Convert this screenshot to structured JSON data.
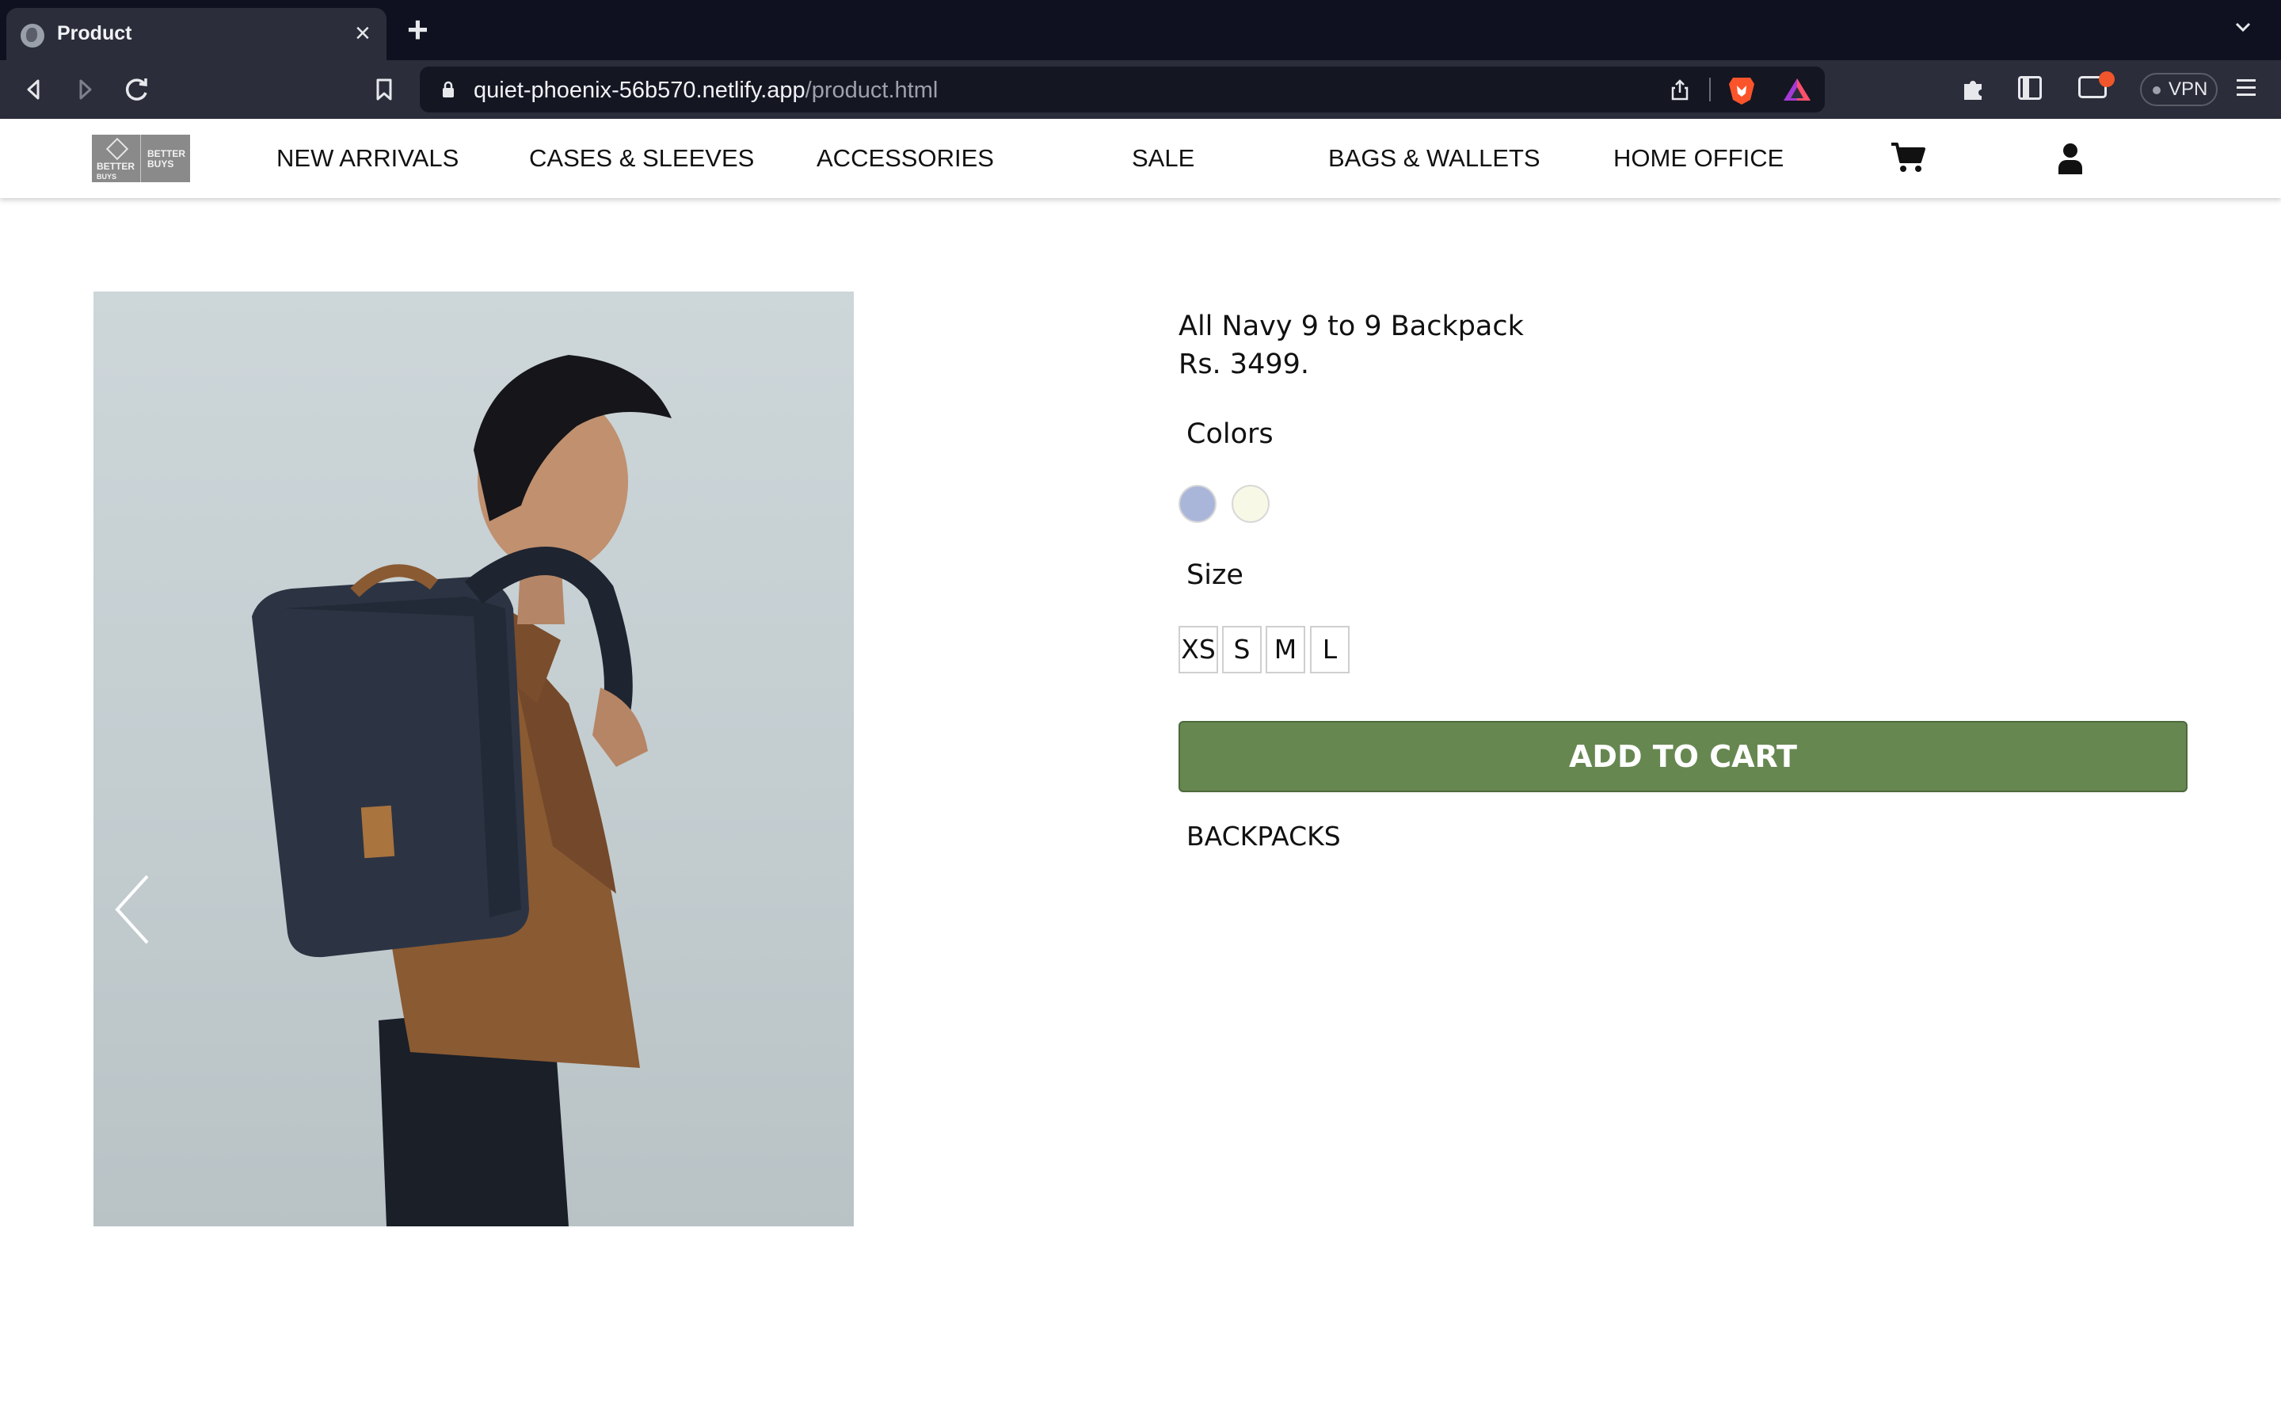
{
  "browser": {
    "tab_title": "Product",
    "tab_close": "×",
    "new_tab": "+",
    "url_host": "quiet-phoenix-56b570.netlify.app",
    "url_path": "/product.html",
    "vpn_label": "VPN",
    "icons": [
      "back-icon",
      "forward-icon",
      "reload-icon",
      "bookmark-icon",
      "lock-icon",
      "share-icon",
      "brave-shields-icon",
      "brave-rewards-icon",
      "extensions-icon",
      "sidebar-icon",
      "wallet-icon",
      "menu-icon"
    ]
  },
  "nav": {
    "logo_text_left": [
      "BETTER",
      "BUYS"
    ],
    "logo_text_right": [
      "BETTER",
      "BUYS"
    ],
    "items": [
      {
        "label": "NEW ARRIVALS"
      },
      {
        "label": "CASES & SLEEVES"
      },
      {
        "label": "ACCESSORIES"
      },
      {
        "label": "SALE"
      },
      {
        "label": "BAGS & WALLETS"
      },
      {
        "label": "HOME OFFICE"
      }
    ]
  },
  "product": {
    "name": "All Navy 9 to 9 Backpack",
    "price": "Rs. 3499.",
    "colors_label": "Colors",
    "colors": [
      "#aab6d9",
      "#f8f8e6"
    ],
    "size_label": "Size",
    "sizes": [
      "XS",
      "S",
      "M",
      "L"
    ],
    "add_to_cart": "ADD TO CART",
    "category": "BACKPACKS"
  }
}
